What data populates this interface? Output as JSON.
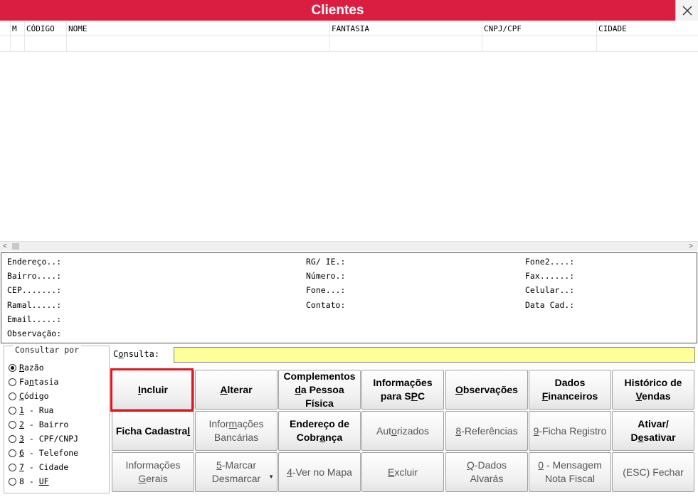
{
  "window": {
    "title": "Clientes",
    "close_glyph": "✕"
  },
  "grid": {
    "columns": [
      "M",
      "CÓDIGO",
      "NOME",
      "FANTASIA",
      "CNPJ/CPF",
      "CIDADE"
    ]
  },
  "details": {
    "endereco": "Endereço..:",
    "bairro": "Bairro....:",
    "cep": "CEP.......:",
    "ramal": "Ramal.....:",
    "email": "Email.....:",
    "observacao": "Observação:",
    "rg_ie": "RG/ IE.:",
    "numero": "Número.:",
    "fone": "Fone...:",
    "contato": "Contato:",
    "fone2": "Fone2....:",
    "fax": "Fax......:",
    "celular": "Celular..:",
    "data_cad": "Data Cad.:"
  },
  "consultar": {
    "legend": "Consultar por",
    "options": [
      {
        "pre": "",
        "u": "R",
        "post": "azão",
        "selected": true
      },
      {
        "pre": "Fa",
        "u": "n",
        "post": "tasia",
        "selected": false
      },
      {
        "pre": "",
        "u": "C",
        "post": "ódigo",
        "selected": false
      },
      {
        "pre": "",
        "u": "1",
        "post": " - Rua",
        "selected": false
      },
      {
        "pre": "",
        "u": "2",
        "post": " - Bairro",
        "selected": false
      },
      {
        "pre": "",
        "u": "3",
        "post": " - CPF/CNPJ",
        "selected": false
      },
      {
        "pre": "",
        "u": "6",
        "post": " - Telefone",
        "selected": false
      },
      {
        "pre": "",
        "u": "7",
        "post": " - Cidade",
        "selected": false
      },
      {
        "pre": "8 - ",
        "u": "UF",
        "post": "",
        "selected": false
      }
    ]
  },
  "search": {
    "label_pre": "C",
    "label_u": "o",
    "label_post": "nsulta:",
    "value": ""
  },
  "buttons": {
    "incluir": {
      "pre": "",
      "u": "I",
      "post": "ncluir"
    },
    "alterar": {
      "pre": "",
      "u": "A",
      "post": "lterar"
    },
    "complementos_1": "Complementos",
    "complementos_2_u": "d",
    "complementos_2_post": "a Pessoa",
    "complementos_3": "Física",
    "info_spc_1": "Informações",
    "info_spc_2_pre": "para S",
    "info_spc_2_u": "P",
    "info_spc_2_post": "C",
    "observacoes": {
      "pre": "",
      "u": "O",
      "post": "bservações"
    },
    "dados_fin_1": "Dados",
    "dados_fin_2_u": "F",
    "dados_fin_2_post": "inanceiros",
    "historico_1": "Histórico de",
    "historico_2_u": "V",
    "historico_2_post": "endas",
    "ficha_cadastral": {
      "pre": "Ficha Cadastra",
      "u": "l",
      "post": ""
    },
    "info_banc_1_pre": "Infor",
    "info_banc_1_u": "m",
    "info_banc_1_post": "ações",
    "info_banc_2": "Bancárias",
    "end_cobranca_1": "Endereço de",
    "end_cobranca_2_pre": "Cobr",
    "end_cobranca_2_u": "a",
    "end_cobranca_2_post": "nça",
    "autorizados": {
      "pre": "Aut",
      "u": "o",
      "post": "rizados"
    },
    "referencias": {
      "pre": "",
      "u": "8",
      "post": "-Referências"
    },
    "ficha_registro": {
      "pre": "",
      "u": "9",
      "post": "-Ficha Registro"
    },
    "ativar_1": "Ativar/",
    "ativar_2_pre": "D",
    "ativar_2_u": "e",
    "ativar_2_post": "sativar",
    "info_gerais_1": "Informações",
    "info_gerais_2_u": "G",
    "info_gerais_2_post": "erais",
    "marcar_1_u": "5",
    "marcar_1_post": "-Marcar",
    "marcar_2": "Desmarcar",
    "ver_mapa": {
      "pre": "",
      "u": "4",
      "post": "-Ver no Mapa"
    },
    "excluir": {
      "pre": "",
      "u": "E",
      "post": "xcluir"
    },
    "dados_alvaras_1_u": "Q",
    "dados_alvaras_1_post": "-Dados",
    "dados_alvaras_2": "Alvarás",
    "mensagem_1_u": "0",
    "mensagem_1_post": " - Mensagem",
    "mensagem_2": "Nota Fiscal",
    "fechar": "(ESC) Fechar"
  }
}
